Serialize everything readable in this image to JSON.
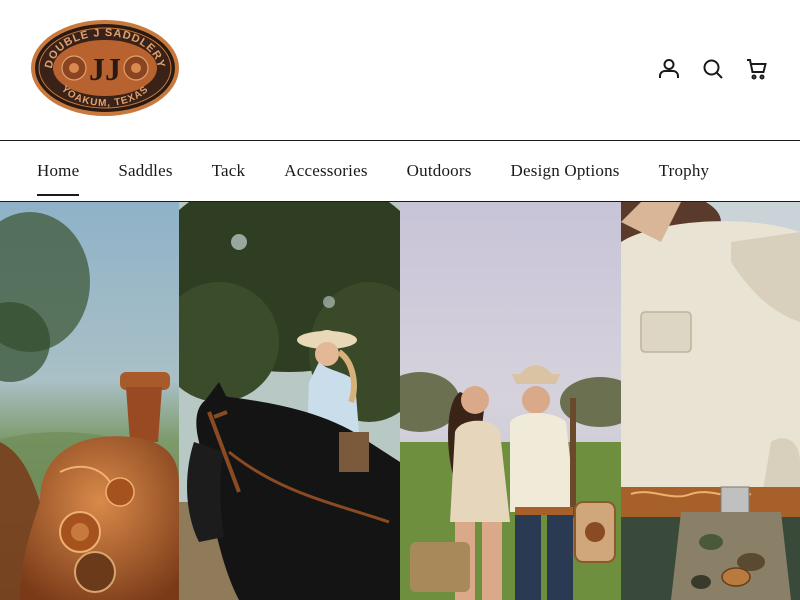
{
  "brand": {
    "logo_top_text": "DOUBLE J SADDLERY",
    "logo_bottom_text": "YOAKUM, TEXAS",
    "logo_monogram": "JJ"
  },
  "header": {
    "icons": [
      "account-icon",
      "search-icon",
      "cart-icon"
    ]
  },
  "nav": {
    "items": [
      {
        "label": "Home",
        "active": true
      },
      {
        "label": "Saddles"
      },
      {
        "label": "Tack"
      },
      {
        "label": "Accessories"
      },
      {
        "label": "Outdoors"
      },
      {
        "label": "Design Options"
      },
      {
        "label": "Trophy"
      }
    ]
  },
  "hero": {
    "panels": [
      {
        "subject": "tooled leather saddle"
      },
      {
        "subject": "woman in cowboy hat riding dark horse"
      },
      {
        "subject": "couple standing in field"
      },
      {
        "subject": "man in khaki shirt with tooled belt and camo bag"
      }
    ]
  },
  "colors": {
    "leather": "#b8632f",
    "logo_dark": "#2a1a12",
    "border": "#1a1a1a"
  }
}
